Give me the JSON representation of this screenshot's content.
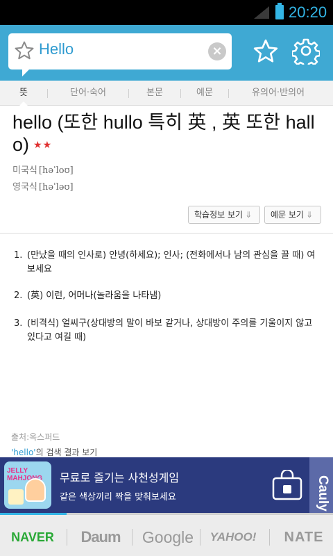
{
  "status_bar": {
    "time": "20:20"
  },
  "search": {
    "query": "Hello"
  },
  "tabs": [
    {
      "label": "뜻",
      "active": true
    },
    {
      "label": "단어·숙어",
      "active": false
    },
    {
      "label": "본문",
      "active": false
    },
    {
      "label": "예문",
      "active": false
    },
    {
      "label": "유의어·반의어",
      "active": false
    }
  ],
  "entry": {
    "headword": "hello (또한 hullo 특히 英 , 英 또한 hallo)",
    "rating_stars": "★★",
    "pronunciations": [
      {
        "label": "미국식",
        "ipa": "[həˈloʊ]"
      },
      {
        "label": "영국식",
        "ipa": "[həˈləʊ]"
      }
    ],
    "buttons": {
      "study_info": "학습정보 보기",
      "examples": "예문 보기",
      "arrow": "⇓"
    }
  },
  "definitions": [
    {
      "num": "1.",
      "text": "(만났을 때의 인사로) 안녕(하세요); 인사; (전화에서나 남의 관심을 끌 때) 여보세요"
    },
    {
      "num": "2.",
      "text": "(英) 이런, 어머나(놀라움을 나타냄)"
    },
    {
      "num": "3.",
      "text": "(비격식) 얼씨구(상대방의 말이 바보 같거나, 상대방이 주의를 기울이지 않고 있다고 여길 때)"
    }
  ],
  "footer": {
    "source": "출처:옥스퍼드",
    "search_keyword": "'hello'",
    "search_suffix": "의 검색 결과 보기"
  },
  "ad": {
    "thumb_text": "JELLY MAHJONG",
    "line1": "무료로 즐기는 사천성게임",
    "line2": "같은 색상끼리 짝을 맞춰보세요",
    "brand": "Cauly"
  },
  "portals": [
    "NAVER",
    "Daum",
    "Google",
    "YAHOO!",
    "NATE"
  ]
}
